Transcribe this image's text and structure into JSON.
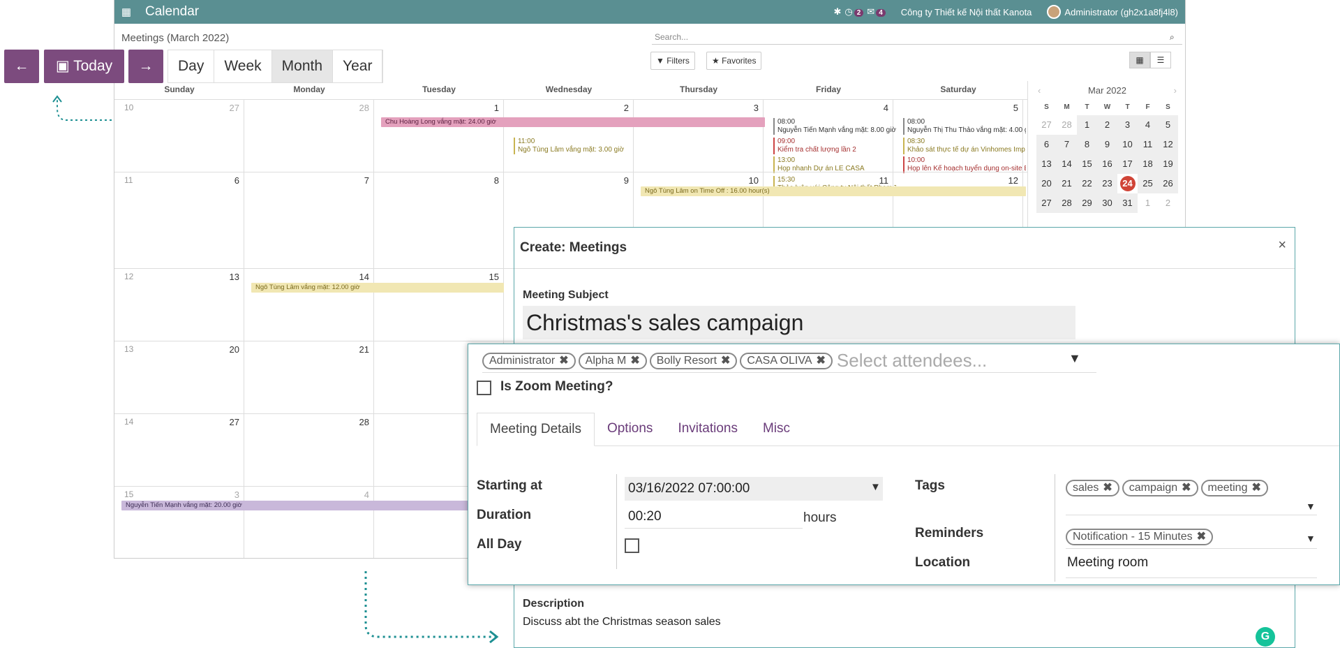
{
  "navbar": {
    "title": "Calendar",
    "activity_count": "2",
    "message_count": "4",
    "company": "Công ty Thiết kế Nội thất Kanota",
    "user": "Administrator (gh2x1a8fj4l8)"
  },
  "control_panel": {
    "breadcrumb": "Meetings (March 2022)",
    "search_placeholder": "Search...",
    "filters_label": "Filters",
    "favorites_label": "Favorites"
  },
  "nav_buttons": {
    "today_label": "Today",
    "views": [
      "Day",
      "Week",
      "Month",
      "Year"
    ],
    "active_view": "Month"
  },
  "calendar": {
    "weekdays": [
      "Sunday",
      "Monday",
      "Tuesday",
      "Wednesday",
      "Thursday",
      "Friday",
      "Saturday"
    ],
    "weeks": [
      {
        "num": "10",
        "days": [
          "27",
          "28",
          "1",
          "2",
          "3",
          "4",
          "5"
        ]
      },
      {
        "num": "11",
        "days": [
          "6",
          "7",
          "8",
          "9",
          "10",
          "11",
          "12"
        ]
      },
      {
        "num": "12",
        "days": [
          "13",
          "14",
          "15",
          "",
          "",
          "",
          ""
        ]
      },
      {
        "num": "13",
        "days": [
          "20",
          "21",
          "",
          "",
          "",
          "",
          ""
        ]
      },
      {
        "num": "14",
        "days": [
          "27",
          "28",
          "",
          "",
          "",
          "",
          ""
        ]
      },
      {
        "num": "15",
        "days": [
          "3",
          "4",
          "",
          "",
          "",
          "",
          ""
        ]
      }
    ],
    "allday_events": {
      "e1": "Chu Hoàng Long vắng mặt: 24.00 giờ",
      "e2": "Ngô Tùng Lâm on Time Off : 16.00 hour(s)",
      "e3": "Ngô Tùng Lâm vắng mặt: 12.00 giờ",
      "e4": "Nguyễn Tiến Mạnh vắng mặt: 20.00 giờ"
    },
    "timed_events": {
      "wed": {
        "time": "11:00",
        "title": "Ngô Tùng Lâm vắng mặt: 3.00 giờ"
      },
      "fri": [
        {
          "time": "08:00",
          "title": "Nguyễn Tiến Mạnh vắng mặt: 8.00 giờ"
        },
        {
          "time": "09:00",
          "title": "Kiểm tra chất lượng lần 2"
        },
        {
          "time": "13:00",
          "title": "Họp nhanh Dự án LE CASA"
        },
        {
          "time": "15:30",
          "title": "Thảo luận với Công ty Nội thất Phạm T"
        }
      ],
      "sat": [
        {
          "time": "08:00",
          "title": "Nguyễn Thị Thu Thảo vắng mặt: 4.00 g"
        },
        {
          "time": "08:30",
          "title": "Khảo sát thực tế dự án Vinhomes Imp"
        },
        {
          "time": "10:00",
          "title": "Họp lên Kế hoạch tuyển dụng on-site E"
        }
      ]
    }
  },
  "mini_calendar": {
    "title": "Mar 2022",
    "headers": [
      "S",
      "M",
      "T",
      "W",
      "T",
      "F",
      "S"
    ],
    "days": [
      "27",
      "28",
      "1",
      "2",
      "3",
      "4",
      "5",
      "6",
      "7",
      "8",
      "9",
      "10",
      "11",
      "12",
      "13",
      "14",
      "15",
      "16",
      "17",
      "18",
      "19",
      "20",
      "21",
      "22",
      "23",
      "24",
      "25",
      "26",
      "27",
      "28",
      "29",
      "30",
      "31",
      "1",
      "2"
    ],
    "today": "24"
  },
  "dialog": {
    "title": "Create: Meetings",
    "subject_label": "Meeting Subject",
    "subject_value": "Christmas's sales campaign",
    "description_label": "Description",
    "description_value": "Discuss abt the Christmas season sales"
  },
  "form": {
    "attendees": [
      "Administrator",
      "Alpha M",
      "Bolly Resort",
      "CASA OLIVA"
    ],
    "attendees_placeholder": "Select attendees...",
    "zoom_label": "Is Zoom Meeting?",
    "tabs": [
      "Meeting Details",
      "Options",
      "Invitations",
      "Misc"
    ],
    "active_tab": "Meeting Details",
    "starting_at_label": "Starting at",
    "starting_at_value": "03/16/2022 07:00:00",
    "duration_label": "Duration",
    "duration_value": "00:20",
    "duration_unit": "hours",
    "allday_label": "All Day",
    "tags_label": "Tags",
    "tags": [
      "sales",
      "campaign",
      "meeting"
    ],
    "reminders_label": "Reminders",
    "reminders": [
      "Notification - 15 Minutes"
    ],
    "location_label": "Location",
    "location_value": "Meeting room"
  },
  "colors": {
    "navbar": "#5a8f92",
    "primary": "#7c4b7e",
    "accent": "#5aa7aa",
    "today": "#d04437"
  }
}
